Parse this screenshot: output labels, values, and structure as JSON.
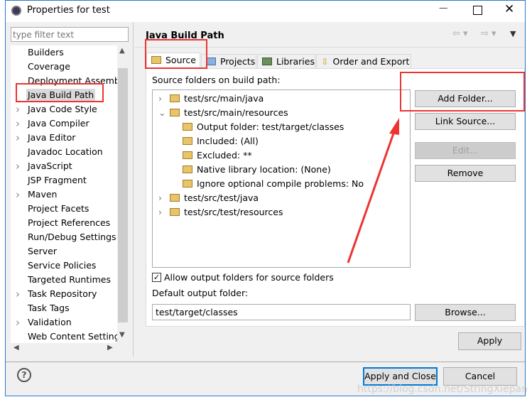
{
  "window": {
    "title": "Properties for test"
  },
  "filter": {
    "placeholder": "type filter text"
  },
  "sidebar": {
    "items": [
      {
        "label": "Builders",
        "chev": false
      },
      {
        "label": "Coverage",
        "chev": false
      },
      {
        "label": "Deployment Assembly",
        "chev": false
      },
      {
        "label": "Java Build Path",
        "chev": false,
        "selected": true
      },
      {
        "label": "Java Code Style",
        "chev": true
      },
      {
        "label": "Java Compiler",
        "chev": true
      },
      {
        "label": "Java Editor",
        "chev": true
      },
      {
        "label": "Javadoc Location",
        "chev": false
      },
      {
        "label": "JavaScript",
        "chev": true
      },
      {
        "label": "JSP Fragment",
        "chev": false
      },
      {
        "label": "Maven",
        "chev": true
      },
      {
        "label": "Project Facets",
        "chev": false
      },
      {
        "label": "Project References",
        "chev": false
      },
      {
        "label": "Run/Debug Settings",
        "chev": false
      },
      {
        "label": "Server",
        "chev": false
      },
      {
        "label": "Service Policies",
        "chev": false
      },
      {
        "label": "Targeted Runtimes",
        "chev": false
      },
      {
        "label": "Task Repository",
        "chev": true
      },
      {
        "label": "Task Tags",
        "chev": false
      },
      {
        "label": "Validation",
        "chev": true
      },
      {
        "label": "Web Content Settings",
        "chev": false
      }
    ]
  },
  "main": {
    "title": "Java Build Path",
    "tabs": [
      {
        "label": "Source",
        "active": true
      },
      {
        "label": "Projects"
      },
      {
        "label": "Libraries"
      },
      {
        "label": "Order and Export"
      }
    ],
    "source_label": "Source folders on build path:",
    "tree": [
      {
        "label": "test/src/main/java",
        "level": 0,
        "toggle": ">"
      },
      {
        "label": "test/src/main/resources",
        "level": 0,
        "toggle": "v"
      },
      {
        "label": "Output folder: test/target/classes",
        "level": 1
      },
      {
        "label": "Included: (All)",
        "level": 1
      },
      {
        "label": "Excluded: **",
        "level": 1
      },
      {
        "label": "Native library location: (None)",
        "level": 1
      },
      {
        "label": "Ignore optional compile problems: No",
        "level": 1
      },
      {
        "label": "test/src/test/java",
        "level": 0,
        "toggle": ">"
      },
      {
        "label": "test/src/test/resources",
        "level": 0,
        "toggle": ">"
      }
    ],
    "buttons": {
      "add_folder": "Add Folder...",
      "link_source": "Link Source...",
      "edit": "Edit...",
      "remove": "Remove",
      "browse": "Browse...",
      "apply": "Apply"
    },
    "allow_output": {
      "label": "Allow output folders for source folders",
      "checked": true
    },
    "default_output_label": "Default output folder:",
    "default_output_value": "test/target/classes"
  },
  "footer": {
    "apply_close": "Apply and Close",
    "cancel": "Cancel"
  },
  "watermark": "https://blog.csdn.net/StringXiepan"
}
